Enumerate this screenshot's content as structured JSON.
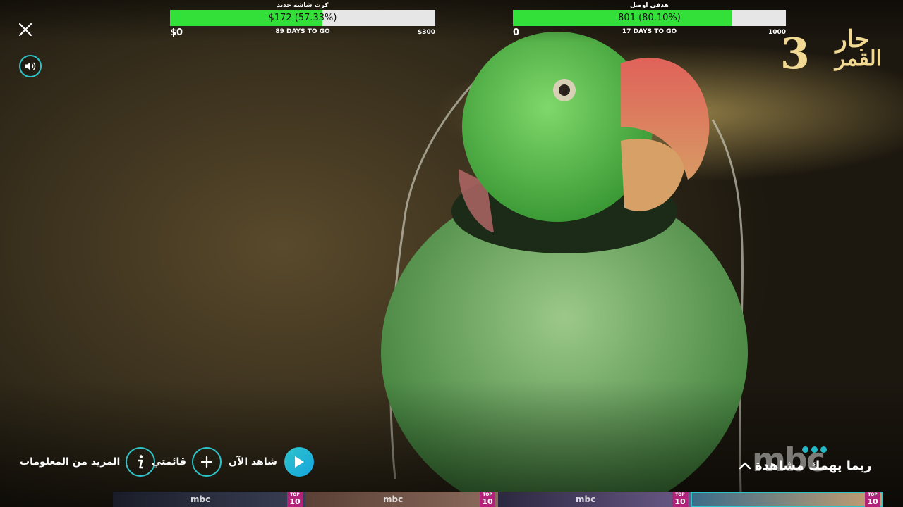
{
  "widgets": [
    {
      "title": "كرت شاشه جديد",
      "bar_text": "$172 (57.33%)",
      "progress": 0.5733,
      "start": "$0",
      "days": "89 DAYS TO GO",
      "goal": "$300"
    },
    {
      "title": "هدفي اوصل",
      "bar_text": "801 (80.10%)",
      "progress": 0.801,
      "start": "0",
      "days": "17 DAYS TO GO",
      "goal": "1000"
    }
  ],
  "controls": {
    "close_icon": "close-icon",
    "volume_icon": "volume-icon"
  },
  "show_logo": {
    "line1": "جار",
    "line2": "القمر",
    "number": "3"
  },
  "actions": {
    "more_info": "المزيد من المعلومات",
    "my_list": "قائمتي",
    "watch_now": "شاهد الآن"
  },
  "channel_logo": "mbc",
  "may_like": "ربما يهمك مشاهدة",
  "thumbnails": [
    {
      "logo": "mbc",
      "badge_top": "TOP",
      "badge_num": "10",
      "colors": [
        "#1a1d28",
        "#3a3f55"
      ]
    },
    {
      "logo": "mbc",
      "badge_top": "TOP",
      "badge_num": "10",
      "colors": [
        "#5a4036",
        "#8b6b5c"
      ]
    },
    {
      "logo": "mbc",
      "badge_top": "TOP",
      "badge_num": "10",
      "colors": [
        "#2c2840",
        "#6a5a88"
      ]
    },
    {
      "logo": "mbc",
      "badge_top": "TOP",
      "badge_num": "10",
      "colors": [
        "#3a6c8a",
        "#c9a070"
      ]
    }
  ],
  "colors": {
    "accent": "#2ec3c9",
    "progress_fill": "#33e03a",
    "progress_track": "#e6e6e6",
    "badge": "#b1227a",
    "logo_gold": "#f2d993"
  }
}
